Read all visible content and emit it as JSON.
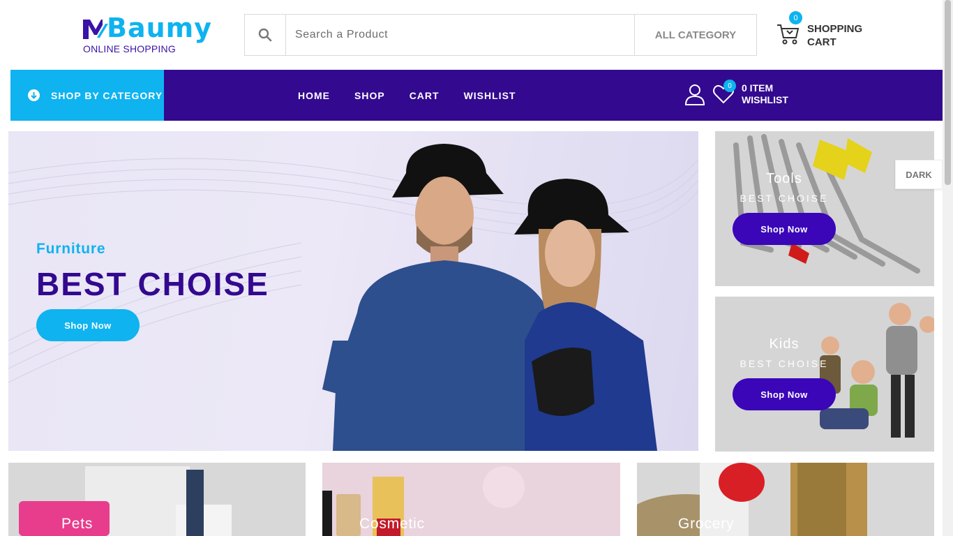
{
  "header": {
    "logo_text": "Baumy",
    "logo_sub": "ONLINE SHOPPING",
    "search_placeholder": "Search a Product",
    "category_select": "ALL CATEGORY",
    "cart_count": "0",
    "cart_line1": "SHOPPING",
    "cart_line2": "CART"
  },
  "nav": {
    "shop_by_category": "SHOP BY CATEGORY",
    "links": [
      "HOME",
      "SHOP",
      "CART",
      "WISHLIST"
    ],
    "wishlist_count": "0",
    "wishlist_line1": "0 ITEM",
    "wishlist_line2": "WISHLIST"
  },
  "hero": {
    "subtitle": "Furniture",
    "title": "BEST CHOISE",
    "button": "Shop Now"
  },
  "side_banners": [
    {
      "title": "Tools",
      "subtitle": "BEST CHOISE",
      "button": "Shop Now"
    },
    {
      "title": "Kids",
      "subtitle": "BEST CHOISE",
      "button": "Shop Now"
    }
  ],
  "theme_toggle": "DARK",
  "category_tiles": [
    {
      "label": "Pets"
    },
    {
      "label": "Cosmetic"
    },
    {
      "label": "Grocery"
    }
  ],
  "colors": {
    "brand_primary": "#33098f",
    "brand_accent": "#0eb3f0",
    "button_purple": "#3a06b8"
  }
}
